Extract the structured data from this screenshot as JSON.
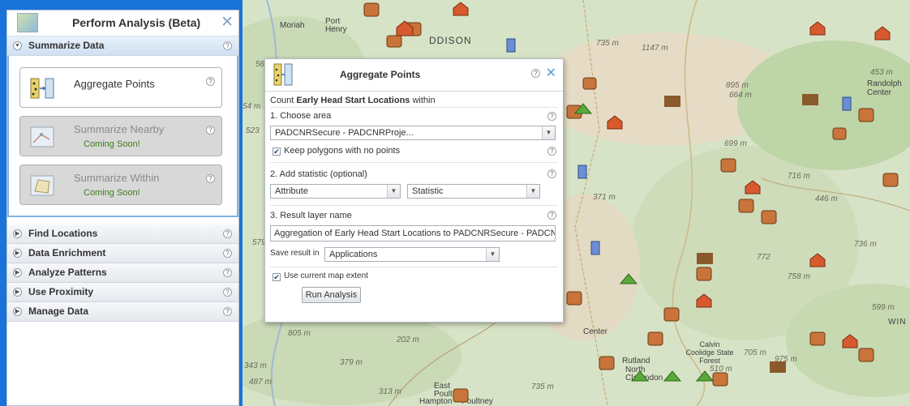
{
  "pane": {
    "title": "Perform Analysis (Beta)",
    "close_icon": "✕",
    "categories_open": {
      "label": "Summarize Data",
      "tools": [
        {
          "label": "Aggregate Points",
          "disabled": false,
          "note": ""
        },
        {
          "label": "Summarize Nearby",
          "disabled": true,
          "note": "Coming Soon!"
        },
        {
          "label": "Summarize Within",
          "disabled": true,
          "note": "Coming Soon!"
        }
      ]
    },
    "categories": [
      "Find Locations",
      "Data Enrichment",
      "Analyze Patterns",
      "Use Proximity",
      "Manage Data"
    ],
    "help_glyph": "?",
    "toggle_glyph": "▶",
    "toggle_open_glyph": "▼"
  },
  "dialog": {
    "title": "Aggregate Points",
    "close_glyph": "✕",
    "count_prefix": "Count ",
    "count_layer": "Early Head Start Locations",
    "count_suffix": " within",
    "step1": "1. Choose area",
    "area_value": "PADCNRSecure - PADCNRProje...",
    "keep_polygons": "Keep polygons with no points",
    "step2": "2. Add statistic (optional)",
    "attribute_value": "Attribute",
    "statistic_value": "Statistic",
    "step3": "3. Result layer name",
    "result_name": "Aggregation of Early Head Start Locations to PADCNRSecure - PADCN",
    "save_in_label": "Save result in",
    "save_in_value": "Applications",
    "use_extent": "Use current map extent",
    "run_label": "Run Analysis"
  },
  "map": {
    "places": [
      "Moriah",
      "Port Henry",
      "DDISON",
      "Randolph Center",
      "Center",
      "Rutland",
      "North Clarendon",
      "East Poultney",
      "Hampton",
      "Poultney",
      "Calvin Coolidge State Forest",
      "WIN"
    ],
    "elevations": [
      "735 m",
      "1147 m",
      "453 m",
      "895 m",
      "664 m",
      "699 m",
      "716 m",
      "446 m",
      "736 m",
      "772",
      "758 m",
      "599 m",
      "805 m",
      "202 m",
      "379 m",
      "343 m",
      "487 m",
      "313 m",
      "735 m",
      "705 m",
      "975 m",
      "510 m",
      "371 m",
      "523",
      "54 m",
      "56",
      "579"
    ]
  }
}
